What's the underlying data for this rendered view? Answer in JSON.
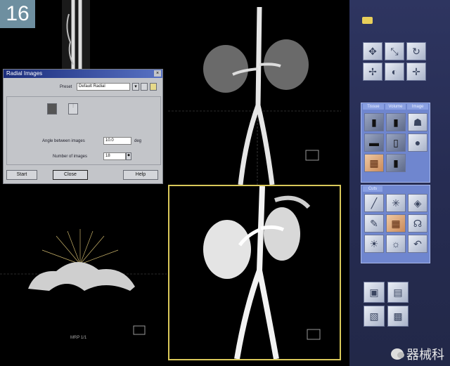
{
  "figure_label": "16",
  "colors": {
    "toolbar_bg": "#262c52",
    "active_viewport_border": "#d9c85a",
    "tab_panel": "#6f86cf",
    "dialog_title": "#1a2c7a"
  },
  "dialog": {
    "title": "Radial Images",
    "preset_label": "Preset",
    "preset_value": "Default Radial",
    "angle_label": "Angle between images",
    "angle_value": "10.0",
    "angle_unit": "deg",
    "number_label": "Number of images",
    "number_value": "18",
    "buttons": {
      "start": "Start",
      "close": "Close",
      "help": "Help"
    }
  },
  "toolbar": {
    "folder_icon": "folder-icon",
    "tool_tabs": [
      "Tissue",
      "Volume",
      "Image"
    ],
    "lower_tab": "Cuts"
  },
  "viewports": {
    "bottom_left_caption": "MRP 1/1"
  },
  "watermark": "器械科"
}
